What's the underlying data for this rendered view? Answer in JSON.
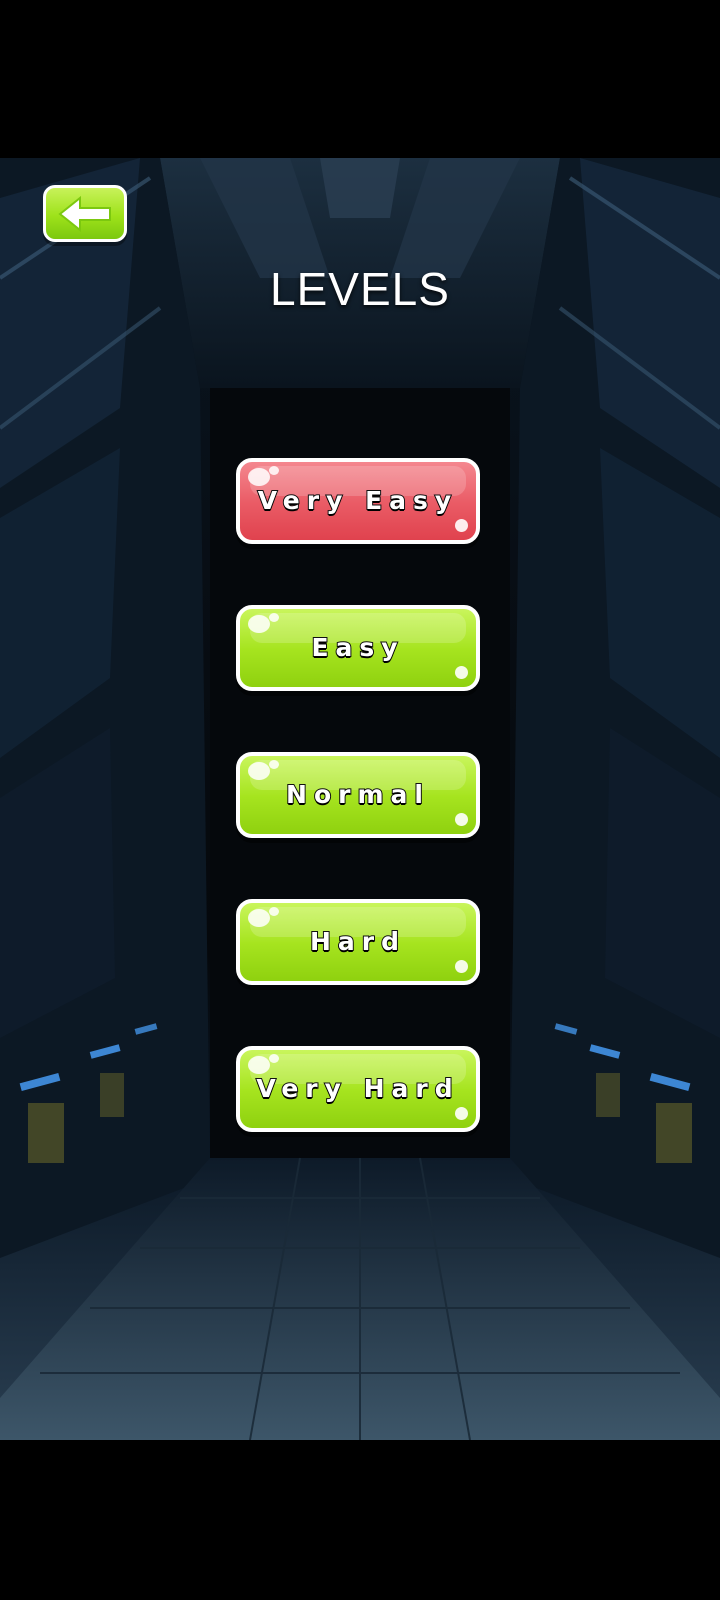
{
  "screen": {
    "title": "LEVELS"
  },
  "back_button": {
    "icon": "arrow-left-icon"
  },
  "levels": [
    {
      "label": "Very Easy",
      "color": "#e9535f"
    },
    {
      "label": "Easy",
      "color": "#a6e41f"
    },
    {
      "label": "Normal",
      "color": "#a6e41f"
    },
    {
      "label": "Hard",
      "color": "#a6e41f"
    },
    {
      "label": "Very Hard",
      "color": "#a6e41f"
    }
  ],
  "colors": {
    "accent_green": "#a6e41f",
    "accent_red": "#e9535f",
    "background": "#000000"
  }
}
